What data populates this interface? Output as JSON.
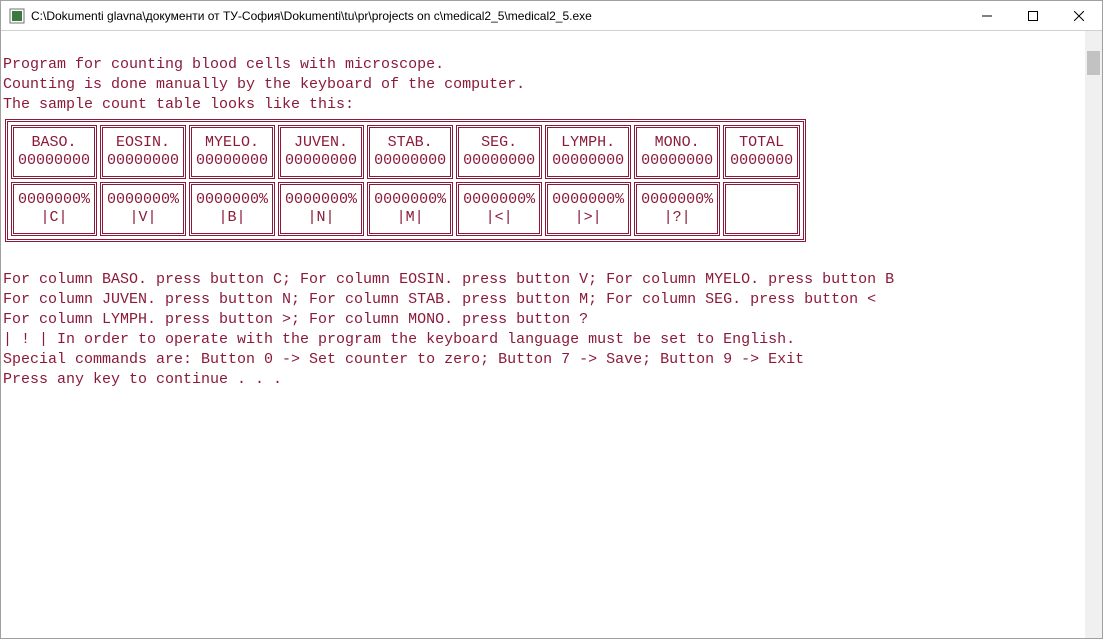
{
  "window": {
    "title": "C:\\Dokumenti glavna\\документи от ТУ-София\\Dokumenti\\tu\\pr\\projects on c\\medical2_5\\medical2_5.exe"
  },
  "intro": {
    "line1": "Program for counting blood cells with microscope.",
    "line2": "Counting is done manually by the keyboard of the computer.",
    "line3": "The sample count table looks like this:"
  },
  "table": {
    "columns": [
      {
        "header": "BASO.",
        "count": "00000000",
        "pct": "0000000%",
        "key": "|C|"
      },
      {
        "header": "EOSIN.",
        "count": "00000000",
        "pct": "0000000%",
        "key": "|V|"
      },
      {
        "header": "MYELO.",
        "count": "00000000",
        "pct": "0000000%",
        "key": "|B|"
      },
      {
        "header": "JUVEN.",
        "count": "00000000",
        "pct": "0000000%",
        "key": "|N|"
      },
      {
        "header": "STAB.",
        "count": "00000000",
        "pct": "0000000%",
        "key": "|M|"
      },
      {
        "header": "SEG.",
        "count": "00000000",
        "pct": "0000000%",
        "key": "|<|"
      },
      {
        "header": "LYMPH.",
        "count": "00000000",
        "pct": "0000000%",
        "key": "|>|"
      },
      {
        "header": "MONO.",
        "count": "00000000",
        "pct": "0000000%",
        "key": "|?|"
      }
    ],
    "total": {
      "header": "TOTAL",
      "count": "0000000"
    }
  },
  "help": {
    "l1": "For column BASO. press button C; For column EOSIN. press button V; For column MYELO. press button B",
    "l2": "For column JUVEN. press button N; For column STAB. press button M; For column SEG. press button <",
    "l3": "For column LYMPH. press button >; For column MONO. press button ?",
    "l4": "| ! | In order to operate with the program the keyboard language must be set to English.",
    "l5": "Special commands are: Button 0 -> Set counter to zero; Button 7 -> Save; Button 9 -> Exit",
    "l6": "Press any key to continue . . ."
  }
}
